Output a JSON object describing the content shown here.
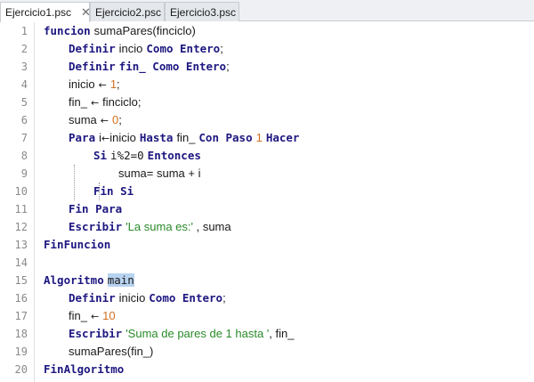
{
  "tabs": [
    {
      "label": "Ejercicio1.psc",
      "close": "✕",
      "active": true
    },
    {
      "label": "Ejercicio2.psc",
      "active": false
    },
    {
      "label": "Ejercicio3.psc",
      "active": false
    }
  ],
  "line_numbers": [
    "1",
    "2",
    "3",
    "4",
    "5",
    "6",
    "7",
    "8",
    "9",
    "10",
    "11",
    "12",
    "13",
    "14",
    "15",
    "16",
    "17",
    "18",
    "19",
    "20"
  ],
  "code": {
    "l1": {
      "kw": "funcion",
      "t": "sumaPares(finciclo)"
    },
    "l2": {
      "kw1": "Definir",
      "t1": "incio",
      "kw2": "Como Entero",
      "t2": ";"
    },
    "l3": {
      "kw1": "Definir",
      "kw2": "fin_ Como Entero",
      "t": ";"
    },
    "l4": {
      "t": "inicio",
      "arrow": "←",
      "num": "1",
      "t2": ";"
    },
    "l5": {
      "t": "fin_",
      "arrow": "←",
      "t2": "finciclo;"
    },
    "l6": {
      "t": "suma",
      "arrow": "←",
      "num": "0",
      "t2": ";"
    },
    "l7": {
      "kw1": "Para",
      "v": "i",
      "arrow": "←",
      "t": "inicio",
      "kw2": "Hasta",
      "t2": "fin_",
      "kw3": "Con Paso",
      "num": "1",
      "kw4": "Hacer"
    },
    "l8": {
      "kw1": "Si",
      "t": "i%2=0",
      "kw2": "Entonces"
    },
    "l9": {
      "t": "suma= suma + i"
    },
    "l10": {
      "kw": "Fin Si"
    },
    "l11": {
      "kw": "Fin Para"
    },
    "l12": {
      "kw": "Escribir",
      "str": "'La suma es:'",
      "t": " , suma"
    },
    "l13": {
      "kw": "FinFuncion"
    },
    "l15": {
      "kw": "Algoritmo",
      "name": "main"
    },
    "l16": {
      "kw1": "Definir",
      "t1": "inicio",
      "kw2": "Como Entero",
      "t2": ";"
    },
    "l17": {
      "t": "fin_",
      "arrow": "←",
      "num": "10"
    },
    "l18": {
      "kw": "Escribir",
      "str": "'Suma de pares de 1 hasta '",
      "t": ", fin_"
    },
    "l19": {
      "t": "sumaPares(fin_)"
    },
    "l20": {
      "kw": "FinAlgoritmo"
    }
  }
}
